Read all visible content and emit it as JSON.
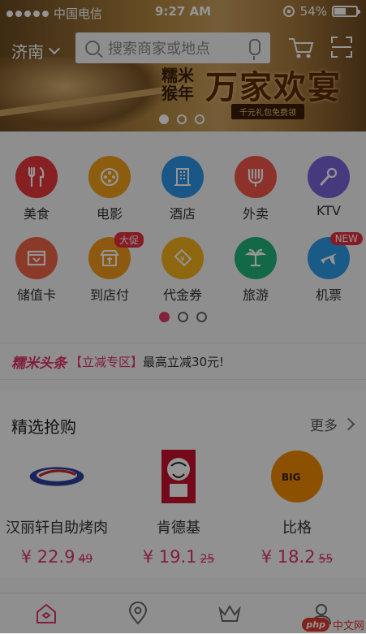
{
  "status_bar": {
    "carrier": "中国电信",
    "time": "9:27 AM",
    "battery": "54%",
    "battery_level": 0.54
  },
  "header": {
    "city": "济南",
    "search_placeholder": "搜索商家或地点"
  },
  "banner": {
    "brand": "糯米猴年",
    "title": "万家欢宴",
    "subtitle": "千元礼包免费领",
    "slides": 3,
    "active_slide": 0
  },
  "categories": [
    {
      "label": "美食",
      "color": "#e9373c",
      "icon": "fork-knife-icon"
    },
    {
      "label": "电影",
      "color": "#f3a11a",
      "icon": "film-reel-icon"
    },
    {
      "label": "酒店",
      "color": "#2d96e8",
      "icon": "building-icon"
    },
    {
      "label": "外卖",
      "color": "#f2564a",
      "icon": "takeout-icon"
    },
    {
      "label": "KTV",
      "color": "#7b62d8",
      "icon": "microphone-icon"
    },
    {
      "label": "储值卡",
      "color": "#f06246",
      "icon": "card-icon"
    },
    {
      "label": "到店付",
      "color": "#f39a1c",
      "icon": "shop-icon",
      "badge": "大促"
    },
    {
      "label": "代金券",
      "color": "#f4b11d",
      "icon": "voucher-icon"
    },
    {
      "label": "旅游",
      "color": "#21b37a",
      "icon": "palm-tree-icon"
    },
    {
      "label": "机票",
      "color": "#2d9be8",
      "icon": "airplane-icon",
      "badge": "NEW"
    }
  ],
  "category_pages": {
    "count": 3,
    "active": 0
  },
  "news": {
    "logo": "糯米头条",
    "tag": "【立减专区】",
    "text": "最高立减30元!"
  },
  "featured": {
    "title": "精选抢购",
    "more": "更多",
    "items": [
      {
        "name": "汉丽轩自助烤肉",
        "price": "¥ 22.9",
        "original": "49"
      },
      {
        "name": "肯德基",
        "price": "¥ 19.1",
        "original": "25"
      },
      {
        "name": "比格",
        "price": "¥ 18.2",
        "original": "55"
      }
    ]
  },
  "tabbar": {
    "tabs": [
      "home-icon",
      "location-icon",
      "crown-icon",
      "profile-icon"
    ]
  },
  "watermark": {
    "badge": "php",
    "text": "中文网"
  }
}
